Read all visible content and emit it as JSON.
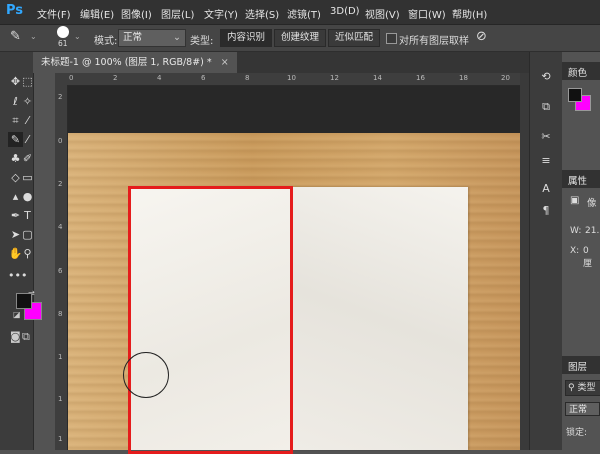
{
  "app": {
    "logo": "Ps"
  },
  "menu": [
    "文件(F)",
    "编辑(E)",
    "图像(I)",
    "图层(L)",
    "文字(Y)",
    "选择(S)",
    "滤镜(T)",
    "3D(D)",
    "视图(V)",
    "窗口(W)",
    "帮助(H)"
  ],
  "options": {
    "brush_size": "61",
    "mode_label": "模式:",
    "mode_value": "正常",
    "type_label": "类型:",
    "type_buttons": [
      "内容识别",
      "创建纹理",
      "近似匹配"
    ],
    "sample_all_label": "对所有图层取样"
  },
  "document": {
    "tab_title": "未标题-1 @ 100% (图层 1, RGB/8#) *",
    "close": "×"
  },
  "ruler_top": [
    "0",
    "2",
    "4",
    "6",
    "8",
    "10",
    "12",
    "14",
    "16",
    "18",
    "20"
  ],
  "ruler_left": [
    "2",
    "0",
    "2",
    "4",
    "6",
    "8",
    "1",
    "1",
    "1"
  ],
  "panels": {
    "color_title": "颜色",
    "properties_title": "属性",
    "properties_value": "像",
    "w_label": "W:",
    "w_value": "21.",
    "x_label": "X:",
    "x_value": "0 厘",
    "layers_title": "图层",
    "layers_search": "类型",
    "blend_mode": "正常",
    "lock_label": "锁定:"
  },
  "colors": {
    "foreground": "#111111",
    "background": "#ff00ff",
    "selection": "#e51c1c",
    "ps_blue": "#31a8ff"
  }
}
